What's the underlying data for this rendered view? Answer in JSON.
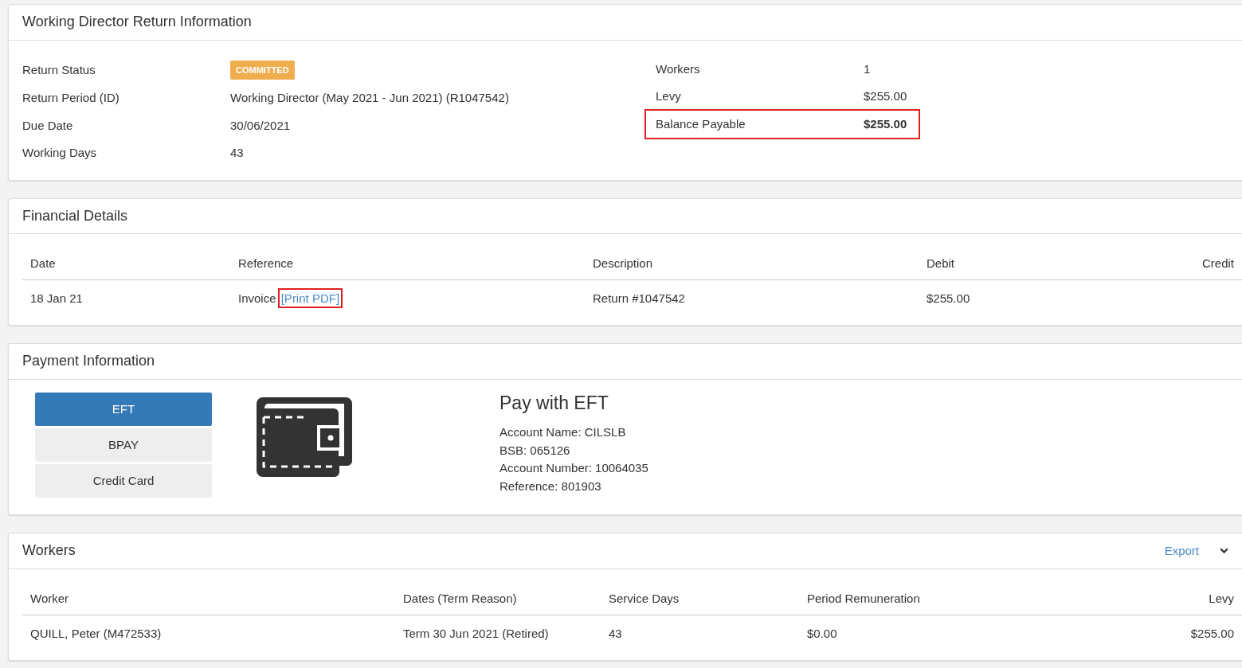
{
  "return_info": {
    "title": "Working Director Return Information",
    "left_fields": [
      {
        "label": "Return Status",
        "value": "COMMITTED",
        "kind": "badge"
      },
      {
        "label": "Return Period (ID)",
        "value": "Working Director (May 2021 - Jun 2021) (R1047542)",
        "kind": "text"
      },
      {
        "label": "Due Date",
        "value": "30/06/2021",
        "kind": "text"
      },
      {
        "label": "Working Days",
        "value": "43",
        "kind": "text"
      }
    ],
    "right_fields": [
      {
        "label": "Workers",
        "value": "1",
        "highlighted": false
      },
      {
        "label": "Levy",
        "value": "$255.00",
        "highlighted": false
      },
      {
        "label": "Balance Payable",
        "value": "$255.00",
        "highlighted": true
      }
    ]
  },
  "financial_details": {
    "title": "Financial Details",
    "columns": [
      "Date",
      "Reference",
      "Description",
      "Debit",
      "Credit"
    ],
    "rows": [
      {
        "date": "18 Jan 21",
        "reference": "Invoice",
        "link": {
          "text": "[Print PDF]",
          "highlighted": true
        },
        "description": "Return #1047542",
        "debit": "$255.00"
      }
    ]
  },
  "payment_information": {
    "title": "Payment Information",
    "methods": [
      {
        "label": "EFT",
        "selected": true
      },
      {
        "label": "BPAY",
        "selected": false
      },
      {
        "label": "Credit Card",
        "selected": false
      }
    ],
    "heading": "Pay with EFT",
    "lines": [
      "Account Name: CILSLB",
      "BSB: 065126",
      "Account Number: 10064035",
      "Reference: 801903"
    ]
  },
  "workers": {
    "title": "Workers",
    "export_link": "Export",
    "columns": [
      "Worker",
      "Dates (Term Reason)",
      "Service Days",
      "Period Remuneration",
      "Levy"
    ],
    "rows": [
      [
        "QUILL, Peter (M472533)",
        "Term 30 Jun 2021 (Retired)",
        "43",
        "$0.00",
        "$255.00"
      ]
    ]
  }
}
